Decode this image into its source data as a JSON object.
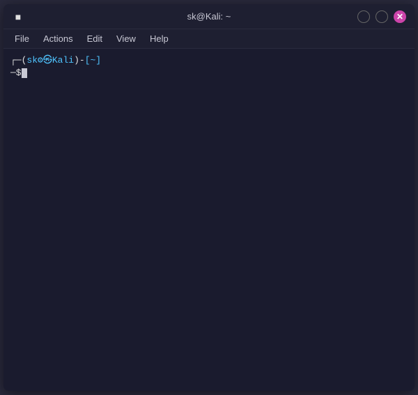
{
  "window": {
    "title": "sk@Kali: ~",
    "icon": "■"
  },
  "controls": {
    "minimize_label": "",
    "maximize_label": "",
    "close_label": "✕"
  },
  "menu": {
    "items": [
      "File",
      "Actions",
      "Edit",
      "View",
      "Help"
    ]
  },
  "terminal": {
    "prompt_user": "sk⚙",
    "prompt_host": "Kali",
    "prompt_dir": "[~]",
    "prompt_prefix": "─$"
  }
}
